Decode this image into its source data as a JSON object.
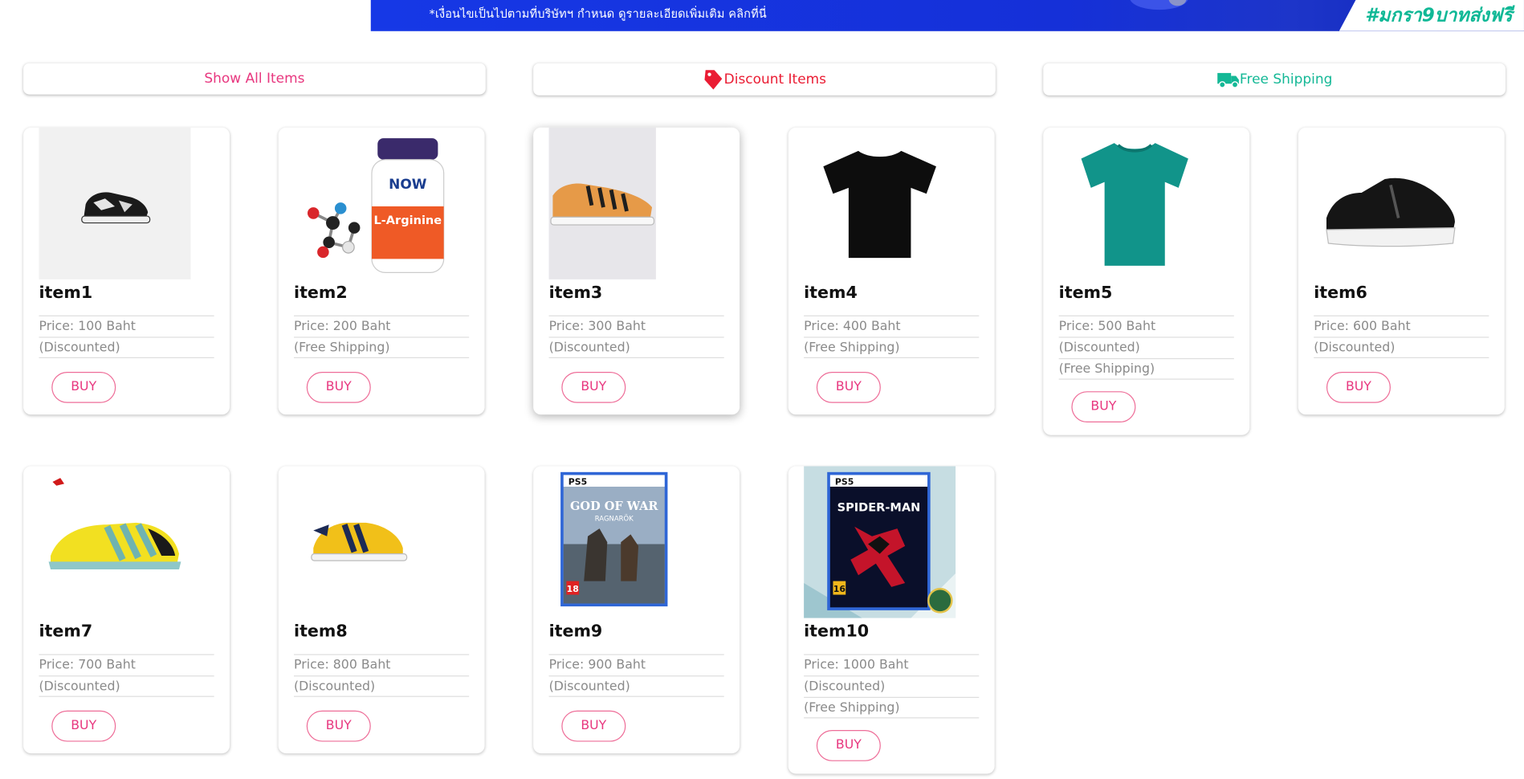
{
  "banner": {
    "note": "*เงื่อนไขเป็นไปตามที่บริษัทฯ กำหนด ดูรายละเอียดเพิ่มเติม คลิกที่นี่",
    "hashtag": "#มกรา9บาทส่งฟรี",
    "color": "#1638e6"
  },
  "filters": {
    "show_all": "Show All Items",
    "discount": "Discount Items",
    "free_shipping": "Free Shipping",
    "discount_icon": "price-tag-icon",
    "free_shipping_icon": "delivery-truck-icon"
  },
  "buy_label": "BUY",
  "items": [
    {
      "name": "item1",
      "price": "Price: 100 Baht",
      "tags": [
        "(Discounted)"
      ],
      "image": "sneaker-image"
    },
    {
      "name": "item2",
      "price": "Price: 200 Baht",
      "tags": [
        "(Free Shipping)"
      ],
      "image": "supplement-bottle-image"
    },
    {
      "name": "item3",
      "price": "Price: 300 Baht",
      "tags": [
        "(Discounted)"
      ],
      "image": "canvas-shoe-image"
    },
    {
      "name": "item4",
      "price": "Price: 400 Baht",
      "tags": [
        "(Free Shipping)"
      ],
      "image": "black-tshirt-image"
    },
    {
      "name": "item5",
      "price": "Price: 500 Baht",
      "tags": [
        "(Discounted)",
        "(Free Shipping)"
      ],
      "image": "teal-tshirt-image"
    },
    {
      "name": "item6",
      "price": "Price: 600 Baht",
      "tags": [
        "(Discounted)"
      ],
      "image": "black-sneaker-image"
    },
    {
      "name": "item7",
      "price": "Price: 700 Baht",
      "tags": [
        "(Discounted)"
      ],
      "image": "yellow-futsal-shoe-image"
    },
    {
      "name": "item8",
      "price": "Price: 800 Baht",
      "tags": [
        "(Discounted)"
      ],
      "image": "yellow-sneaker-image"
    },
    {
      "name": "item9",
      "price": "Price: 900 Baht",
      "tags": [
        "(Discounted)"
      ],
      "image": "ps5-god-of-war-image"
    },
    {
      "name": "item10",
      "price": "Price: 1000 Baht",
      "tags": [
        "(Discounted)",
        "(Free Shipping)"
      ],
      "image": "ps5-spider-man-image"
    }
  ],
  "colors": {
    "accent": "#e8377f",
    "discount": "#ea1c33",
    "free_shipping": "#14b896"
  },
  "product_art": {
    "item2_brand": "NOW",
    "item2_label": "L-Arginine",
    "item9_platform": "PS5",
    "item9_title": "GOD OF WAR",
    "item9_subtitle": "RAGNARÖK",
    "item9_rating": "18",
    "item10_platform": "PS5",
    "item10_title": "SPIDER-MAN",
    "item10_rating": "16"
  }
}
